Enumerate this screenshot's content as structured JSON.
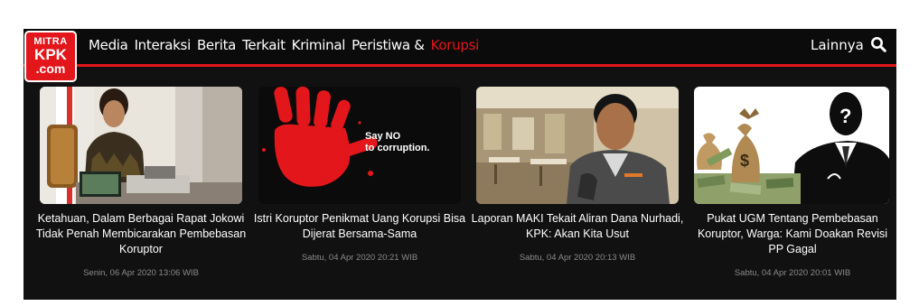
{
  "logo": {
    "line1": "MITRA",
    "line2": "KPK",
    "line3": ".com"
  },
  "nav": {
    "items": [
      {
        "label": "Media"
      },
      {
        "label": "Interaksi"
      },
      {
        "label": "Berita"
      },
      {
        "label": "Terkait"
      },
      {
        "label": "Kriminal"
      },
      {
        "label": "Peristiwa &"
      },
      {
        "label": "Korupsi"
      }
    ],
    "active": "Korupsi",
    "more_label": "Lainnya"
  },
  "image_text": {
    "say_no": "Say NO",
    "to_corruption": "to corruption."
  },
  "articles": [
    {
      "title": "Ketahuan, Dalam Berbagai Rapat Jokowi Tidak Penah Membicarakan Pembebasan Koruptor",
      "date": "Senin, 06 Apr 2020 13:06 WIB"
    },
    {
      "title": "Istri Koruptor Penikmat Uang Korupsi Bisa Dijerat Bersama-Sama",
      "date": "Sabtu, 04 Apr 2020 20:21 WIB"
    },
    {
      "title": "Laporan MAKI Tekait Aliran Dana Nurhadi, KPK: Akan Kita Usut",
      "date": "Sabtu, 04 Apr 2020 20:13 WIB"
    },
    {
      "title": "Pukat UGM Tentang Pembebasan Koruptor, Warga: Kami Doakan Revisi PP Gagal",
      "date": "Sabtu, 04 Apr 2020 20:01 WIB"
    }
  ],
  "colors": {
    "accent": "#e3161b",
    "background": "#111111",
    "topbar": "#0b0b0b",
    "date_text": "#8a8a8a"
  },
  "icons": {
    "search": "search-icon"
  }
}
